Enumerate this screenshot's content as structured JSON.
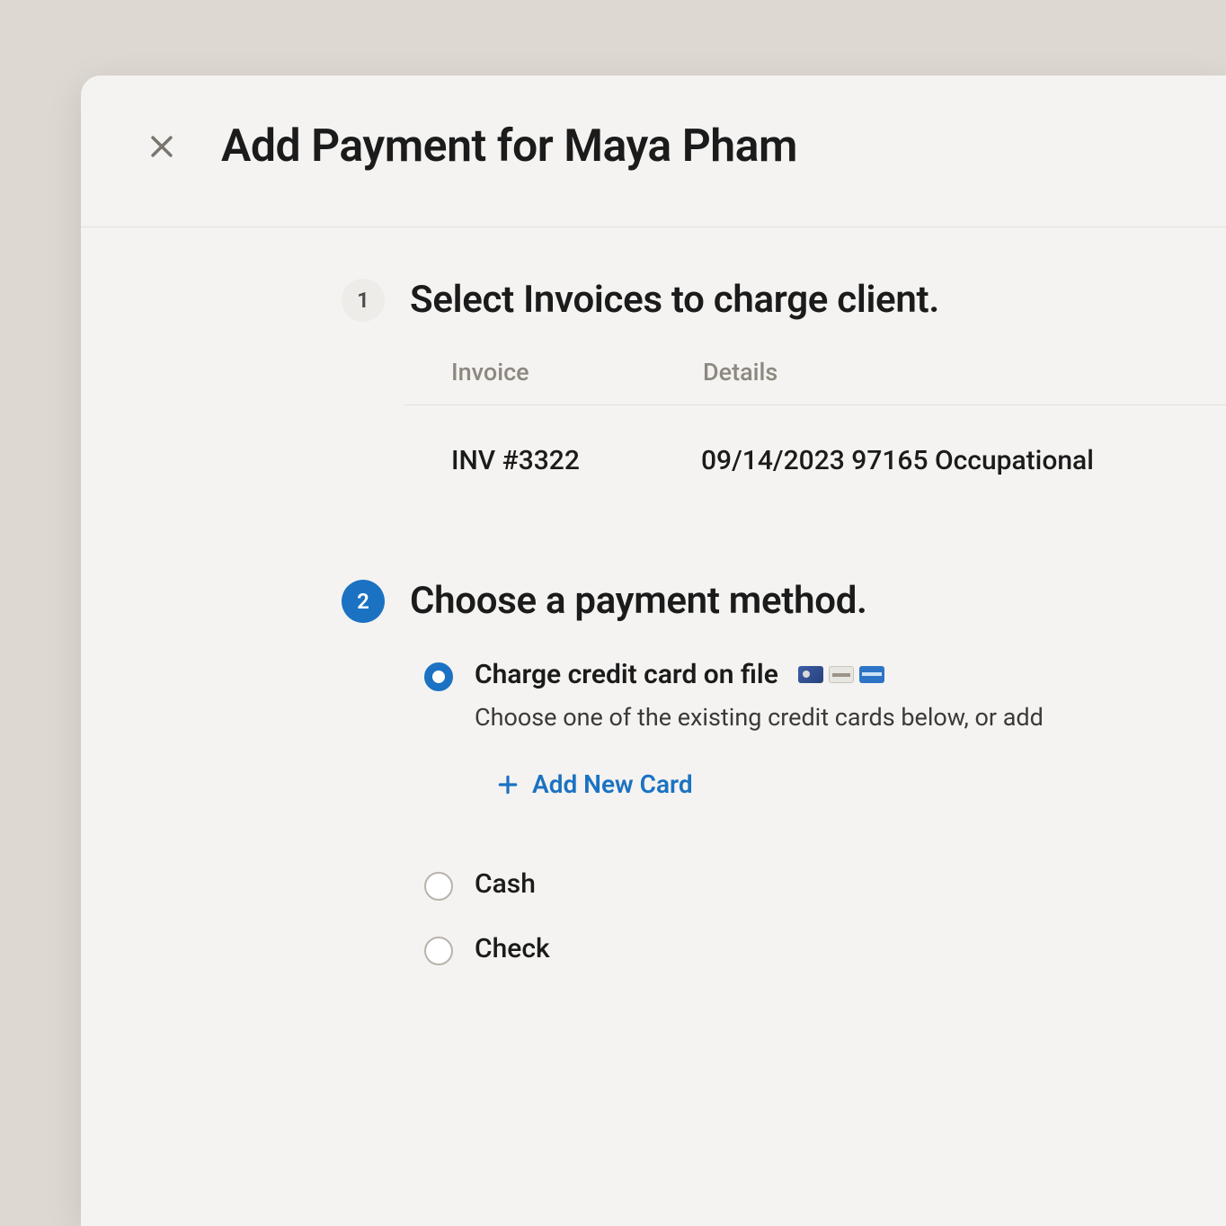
{
  "header": {
    "title": "Add Payment for Maya Pham"
  },
  "steps": {
    "step1": {
      "number": "1",
      "title": "Select Invoices to charge client.",
      "columns": {
        "invoice": "Invoice",
        "details": "Details"
      },
      "rows": [
        {
          "invoice": "INV #3322",
          "details": "09/14/2023 97165 Occupational"
        }
      ]
    },
    "step2": {
      "number": "2",
      "title": "Choose a payment method.",
      "options": {
        "credit_card": {
          "label": "Charge credit card on file",
          "desc": "Choose one of the existing credit cards below, or add",
          "add_new": "Add New Card"
        },
        "cash": {
          "label": "Cash"
        },
        "check": {
          "label": "Check"
        }
      }
    }
  }
}
